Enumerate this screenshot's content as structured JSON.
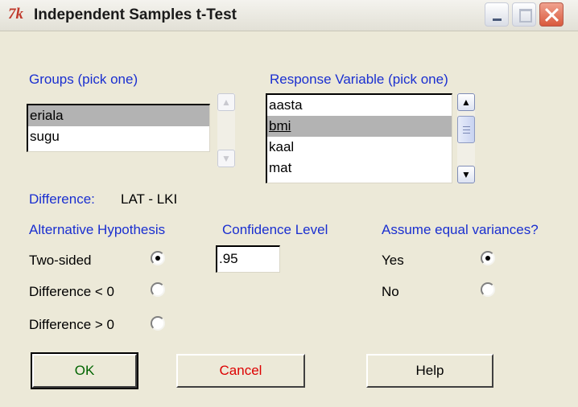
{
  "window": {
    "icon_text": "7k",
    "title": "Independent Samples t-Test"
  },
  "groups": {
    "label": "Groups (pick one)",
    "items": [
      "eriala",
      "sugu"
    ],
    "selected_index": 0
  },
  "response": {
    "label": "Response Variable (pick one)",
    "items": [
      "aasta",
      "bmi",
      "kaal",
      "mat"
    ],
    "selected_index": 1
  },
  "difference": {
    "label": "Difference:",
    "value": "LAT - LKI"
  },
  "alternative": {
    "label": "Alternative Hypothesis",
    "options": [
      "Two-sided",
      "Difference < 0",
      "Difference > 0"
    ],
    "selected_index": 0
  },
  "confidence": {
    "label": "Confidence Level",
    "value": ".95"
  },
  "variances": {
    "label": "Assume equal variances?",
    "options": [
      "Yes",
      "No"
    ],
    "selected_index": 0
  },
  "buttons": {
    "ok": "OK",
    "cancel": "Cancel",
    "help": "Help"
  },
  "colors": {
    "section_label": "#1a2fd0",
    "ok_text": "#006400",
    "cancel_text": "#dd0000",
    "selection": "#b3b3b3"
  }
}
